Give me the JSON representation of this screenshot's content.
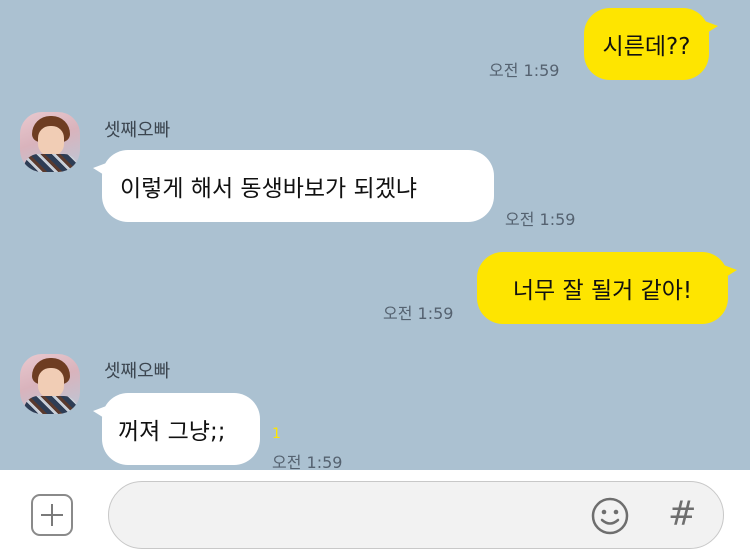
{
  "messages": [
    {
      "text": "시른데??",
      "time": "오전 1:59"
    },
    {
      "sender": "셋째오빠",
      "text": "이렇게 해서 동생바보가 되겠냐",
      "time": "오전 1:59"
    },
    {
      "text": "너무 잘 될거 같아!",
      "time": "오전 1:59"
    },
    {
      "sender": "셋째오빠",
      "text": "꺼져 그냥;;",
      "time": "오전 1:59",
      "unread": "1"
    }
  ],
  "input": {
    "placeholder": ""
  },
  "icons": {
    "plus": "plus-icon",
    "emoji": "emoji-icon",
    "hash": "hash-icon"
  },
  "colors": {
    "background": "#abc1d1",
    "my_bubble": "#fee500",
    "other_bubble": "#ffffff"
  }
}
